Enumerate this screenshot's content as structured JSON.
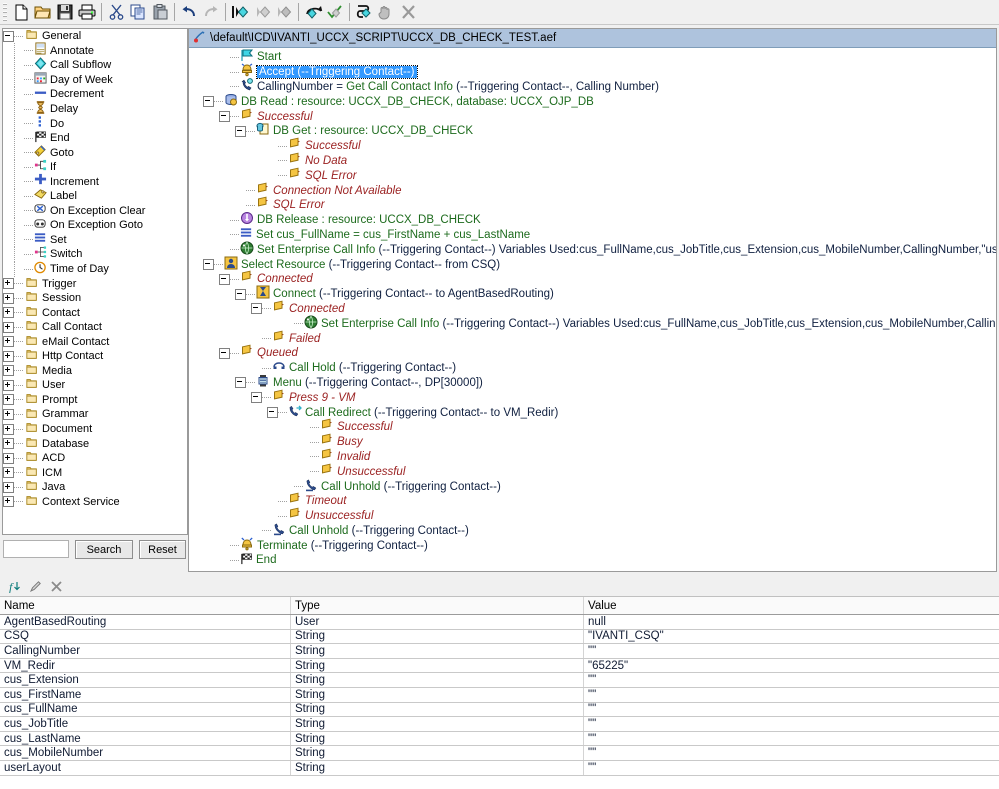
{
  "toolbar": {
    "buttons": [
      {
        "name": "new-file-button",
        "icon": "new-document-icon"
      },
      {
        "name": "open-file-button",
        "icon": "open-folder-icon"
      },
      {
        "name": "save-file-button",
        "icon": "floppy-disk-icon"
      },
      {
        "name": "print-button",
        "icon": "printer-icon"
      },
      {
        "name": "cut-button",
        "icon": "scissors-icon"
      },
      {
        "name": "copy-button",
        "icon": "copy-icon"
      },
      {
        "name": "paste-button",
        "icon": "paste-icon"
      },
      {
        "name": "undo-button",
        "icon": "undo-arrow-icon"
      },
      {
        "name": "redo-button",
        "icon": "redo-arrow-icon"
      },
      {
        "name": "step-into-button",
        "icon": "step-into-icon"
      },
      {
        "name": "step-over-button",
        "icon": "step-over-icon"
      },
      {
        "name": "step-out-button",
        "icon": "step-out-icon"
      },
      {
        "name": "validate-button",
        "icon": "validate-icon"
      },
      {
        "name": "check-syntax-button",
        "icon": "check-icon"
      },
      {
        "name": "debug-button",
        "icon": "debug-icon"
      },
      {
        "name": "pause-button",
        "icon": "hand-icon"
      },
      {
        "name": "stop-debug-button",
        "icon": "stop-x-icon"
      }
    ]
  },
  "palette": {
    "items": [
      {
        "label": "General",
        "depth": 0,
        "type": "folder",
        "expanded": true
      },
      {
        "label": "Annotate",
        "depth": 1,
        "type": "leaf",
        "icon": "annotate-icon"
      },
      {
        "label": "Call Subflow",
        "depth": 1,
        "type": "leaf",
        "icon": "call-subflow-icon"
      },
      {
        "label": "Day of Week",
        "depth": 1,
        "type": "leaf",
        "icon": "calendar-icon"
      },
      {
        "label": "Decrement",
        "depth": 1,
        "type": "leaf",
        "icon": "decrement-icon"
      },
      {
        "label": "Delay",
        "depth": 1,
        "type": "leaf",
        "icon": "hourglass-icon"
      },
      {
        "label": "Do",
        "depth": 1,
        "type": "leaf",
        "icon": "do-icon"
      },
      {
        "label": "End",
        "depth": 1,
        "type": "leaf",
        "icon": "checkered-flag-icon"
      },
      {
        "label": "Goto",
        "depth": 1,
        "type": "leaf",
        "icon": "goto-icon"
      },
      {
        "label": "If",
        "depth": 1,
        "type": "leaf",
        "icon": "if-branch-icon"
      },
      {
        "label": "Increment",
        "depth": 1,
        "type": "leaf",
        "icon": "plus-icon"
      },
      {
        "label": "Label",
        "depth": 1,
        "type": "leaf",
        "icon": "tag-icon"
      },
      {
        "label": "On Exception Clear",
        "depth": 1,
        "type": "leaf",
        "icon": "exception-clear-icon"
      },
      {
        "label": "On Exception Goto",
        "depth": 1,
        "type": "leaf",
        "icon": "exception-goto-icon"
      },
      {
        "label": "Set",
        "depth": 1,
        "type": "leaf",
        "icon": "set-icon"
      },
      {
        "label": "Switch",
        "depth": 1,
        "type": "leaf",
        "icon": "switch-icon"
      },
      {
        "label": "Time of Day",
        "depth": 1,
        "type": "leaf",
        "icon": "clock-icon"
      },
      {
        "label": "Trigger",
        "depth": 0,
        "type": "folder",
        "expanded": false
      },
      {
        "label": "Session",
        "depth": 0,
        "type": "folder",
        "expanded": false
      },
      {
        "label": "Contact",
        "depth": 0,
        "type": "folder",
        "expanded": false
      },
      {
        "label": "Call Contact",
        "depth": 0,
        "type": "folder",
        "expanded": false
      },
      {
        "label": "eMail Contact",
        "depth": 0,
        "type": "folder",
        "expanded": false
      },
      {
        "label": "Http Contact",
        "depth": 0,
        "type": "folder",
        "expanded": false
      },
      {
        "label": "Media",
        "depth": 0,
        "type": "folder",
        "expanded": false
      },
      {
        "label": "User",
        "depth": 0,
        "type": "folder",
        "expanded": false
      },
      {
        "label": "Prompt",
        "depth": 0,
        "type": "folder",
        "expanded": false
      },
      {
        "label": "Grammar",
        "depth": 0,
        "type": "folder",
        "expanded": false
      },
      {
        "label": "Document",
        "depth": 0,
        "type": "folder",
        "expanded": false
      },
      {
        "label": "Database",
        "depth": 0,
        "type": "folder",
        "expanded": false
      },
      {
        "label": "ACD",
        "depth": 0,
        "type": "folder",
        "expanded": false
      },
      {
        "label": "ICM",
        "depth": 0,
        "type": "folder",
        "expanded": false
      },
      {
        "label": "Java",
        "depth": 0,
        "type": "folder",
        "expanded": false
      },
      {
        "label": "Context Service",
        "depth": 0,
        "type": "folder",
        "expanded": false
      }
    ]
  },
  "search": {
    "value": "",
    "placeholder": "",
    "search_label": "Search",
    "reset_label": "Reset"
  },
  "script": {
    "title": "\\default\\ICD\\IVANTI_UCCX_SCRIPT\\UCCX_DB_CHECK_TEST.aef",
    "title_icon": "script-file-icon",
    "rows": [
      {
        "depth": 1,
        "tw": "none",
        "icon": "start-flag-icon",
        "text": "Start",
        "style": "green",
        "selected": false
      },
      {
        "depth": 1,
        "tw": "none",
        "icon": "accept-icon",
        "text": "Accept (--Triggering Contact--)",
        "style": "green",
        "selected": true
      },
      {
        "depth": 1,
        "tw": "none",
        "icon": "get-call-info-icon",
        "text": "CallingNumber = Get Call Contact Info (--Triggering Contact--, Calling Number)",
        "style": "mixed-assign",
        "selected": false
      },
      {
        "depth": 0,
        "tw": "minus",
        "icon": "db-read-icon",
        "text": "DB Read : resource: UCCX_DB_CHECK, database: UCCX_OJP_DB",
        "style": "green",
        "selected": false
      },
      {
        "depth": 1,
        "tw": "minus",
        "icon": "branch-icon",
        "text": "Successful",
        "style": "red-it",
        "selected": false
      },
      {
        "depth": 2,
        "tw": "minus",
        "icon": "db-get-icon",
        "text": "DB Get : resource: UCCX_DB_CHECK",
        "style": "green",
        "selected": false
      },
      {
        "depth": 4,
        "tw": "none",
        "icon": "branch-icon",
        "text": "Successful",
        "style": "red-it",
        "selected": false
      },
      {
        "depth": 4,
        "tw": "none",
        "icon": "branch-icon",
        "text": "No Data",
        "style": "red-it",
        "selected": false
      },
      {
        "depth": 4,
        "tw": "none",
        "icon": "branch-icon",
        "text": "SQL Error",
        "style": "red-it",
        "selected": false
      },
      {
        "depth": 2,
        "tw": "none",
        "icon": "branch-icon",
        "text": "Connection Not Available",
        "style": "red-it",
        "selected": false
      },
      {
        "depth": 2,
        "tw": "none",
        "icon": "branch-icon",
        "text": "SQL Error",
        "style": "red-it",
        "selected": false
      },
      {
        "depth": 1,
        "tw": "none",
        "icon": "db-release-icon",
        "text": "DB Release : resource: UCCX_DB_CHECK",
        "style": "green",
        "selected": false
      },
      {
        "depth": 1,
        "tw": "none",
        "icon": "set-icon",
        "text": "Set cus_FullName = cus_FirstName + cus_LastName",
        "style": "green",
        "selected": false
      },
      {
        "depth": 1,
        "tw": "none",
        "icon": "enterprise-info-icon",
        "text": "Set Enterprise Call Info (--Triggering Contact--) Variables Used:cus_FullName,cus_JobTitle,cus_Extension,cus_MobileNumber,CallingNumber,\"userLayout\"",
        "style": "green",
        "selected": false
      },
      {
        "depth": 0,
        "tw": "minus",
        "icon": "select-resource-icon",
        "text": "Select Resource (--Triggering Contact-- from CSQ)",
        "style": "green",
        "selected": false
      },
      {
        "depth": 1,
        "tw": "minus",
        "icon": "branch-icon",
        "text": "Connected",
        "style": "red-it",
        "selected": false
      },
      {
        "depth": 2,
        "tw": "minus",
        "icon": "connect-icon",
        "text": "Connect (--Triggering Contact-- to AgentBasedRouting)",
        "style": "green",
        "selected": false
      },
      {
        "depth": 3,
        "tw": "minus",
        "icon": "branch-icon",
        "text": "Connected",
        "style": "red-it",
        "selected": false
      },
      {
        "depth": 5,
        "tw": "none",
        "icon": "enterprise-info-icon",
        "text": "Set Enterprise Call Info (--Triggering Contact--) Variables Used:cus_FullName,cus_JobTitle,cus_Extension,cus_MobileNumber,CallingNumber,\"userLayout\"",
        "style": "green",
        "selected": false
      },
      {
        "depth": 3,
        "tw": "none",
        "icon": "branch-icon",
        "text": "Failed",
        "style": "red-it",
        "selected": false
      },
      {
        "depth": 1,
        "tw": "minus",
        "icon": "branch-icon",
        "text": "Queued",
        "style": "red-it",
        "selected": false
      },
      {
        "depth": 3,
        "tw": "none",
        "icon": "call-hold-icon",
        "text": "Call Hold (--Triggering Contact--)",
        "style": "green",
        "selected": false
      },
      {
        "depth": 2,
        "tw": "minus",
        "icon": "menu-icon",
        "text": "Menu (--Triggering Contact--, DP[30000])",
        "style": "green",
        "selected": false
      },
      {
        "depth": 3,
        "tw": "minus",
        "icon": "branch-icon",
        "text": "Press 9 - VM",
        "style": "red-it",
        "selected": false
      },
      {
        "depth": 4,
        "tw": "minus",
        "icon": "call-redirect-icon",
        "text": "Call Redirect (--Triggering Contact-- to VM_Redir)",
        "style": "green",
        "selected": false
      },
      {
        "depth": 6,
        "tw": "none",
        "icon": "branch-icon",
        "text": "Successful",
        "style": "red-it",
        "selected": false
      },
      {
        "depth": 6,
        "tw": "none",
        "icon": "branch-icon",
        "text": "Busy",
        "style": "red-it",
        "selected": false
      },
      {
        "depth": 6,
        "tw": "none",
        "icon": "branch-icon",
        "text": "Invalid",
        "style": "red-it",
        "selected": false
      },
      {
        "depth": 6,
        "tw": "none",
        "icon": "branch-icon",
        "text": "Unsuccessful",
        "style": "red-it",
        "selected": false
      },
      {
        "depth": 5,
        "tw": "none",
        "icon": "call-unhold-icon",
        "text": "Call Unhold (--Triggering Contact--)",
        "style": "green",
        "selected": false
      },
      {
        "depth": 4,
        "tw": "none",
        "icon": "branch-icon",
        "text": "Timeout",
        "style": "red-it",
        "selected": false
      },
      {
        "depth": 4,
        "tw": "none",
        "icon": "branch-icon",
        "text": "Unsuccessful",
        "style": "red-it",
        "selected": false
      },
      {
        "depth": 3,
        "tw": "none",
        "icon": "call-unhold-icon",
        "text": "Call Unhold (--Triggering Contact--)",
        "style": "green",
        "selected": false
      },
      {
        "depth": 1,
        "tw": "none",
        "icon": "terminate-icon",
        "text": "Terminate (--Triggering Contact--)",
        "style": "green",
        "selected": false
      },
      {
        "depth": 1,
        "tw": "none",
        "icon": "checkered-flag-icon",
        "text": "End",
        "style": "green",
        "selected": false
      }
    ]
  },
  "variables": {
    "toolbar_buttons": [
      {
        "name": "add-variable-button",
        "icon": "add-variable-icon"
      },
      {
        "name": "edit-variable-button",
        "icon": "pencil-icon"
      },
      {
        "name": "delete-variable-button",
        "icon": "delete-x-icon"
      }
    ],
    "columns": [
      "Name",
      "Type",
      "Value"
    ],
    "rows": [
      {
        "name": "AgentBasedRouting",
        "type": "User",
        "value": "null"
      },
      {
        "name": "CSQ",
        "type": "String",
        "value": "\"IVANTI_CSQ\""
      },
      {
        "name": "CallingNumber",
        "type": "String",
        "value": "\"\""
      },
      {
        "name": "VM_Redir",
        "type": "String",
        "value": "\"65225\""
      },
      {
        "name": "cus_Extension",
        "type": "String",
        "value": "\"\""
      },
      {
        "name": "cus_FirstName",
        "type": "String",
        "value": "\"\""
      },
      {
        "name": "cus_FullName",
        "type": "String",
        "value": "\"\""
      },
      {
        "name": "cus_JobTitle",
        "type": "String",
        "value": "\"\""
      },
      {
        "name": "cus_LastName",
        "type": "String",
        "value": "\"\""
      },
      {
        "name": "cus_MobileNumber",
        "type": "String",
        "value": "\"\""
      },
      {
        "name": "userLayout",
        "type": "String",
        "value": "\"\""
      }
    ]
  },
  "colors": {
    "title_bar": "#aec3dd",
    "selection": "#3399ff",
    "green_text": "#1d6b1d",
    "red_italic": "#9b2222"
  }
}
